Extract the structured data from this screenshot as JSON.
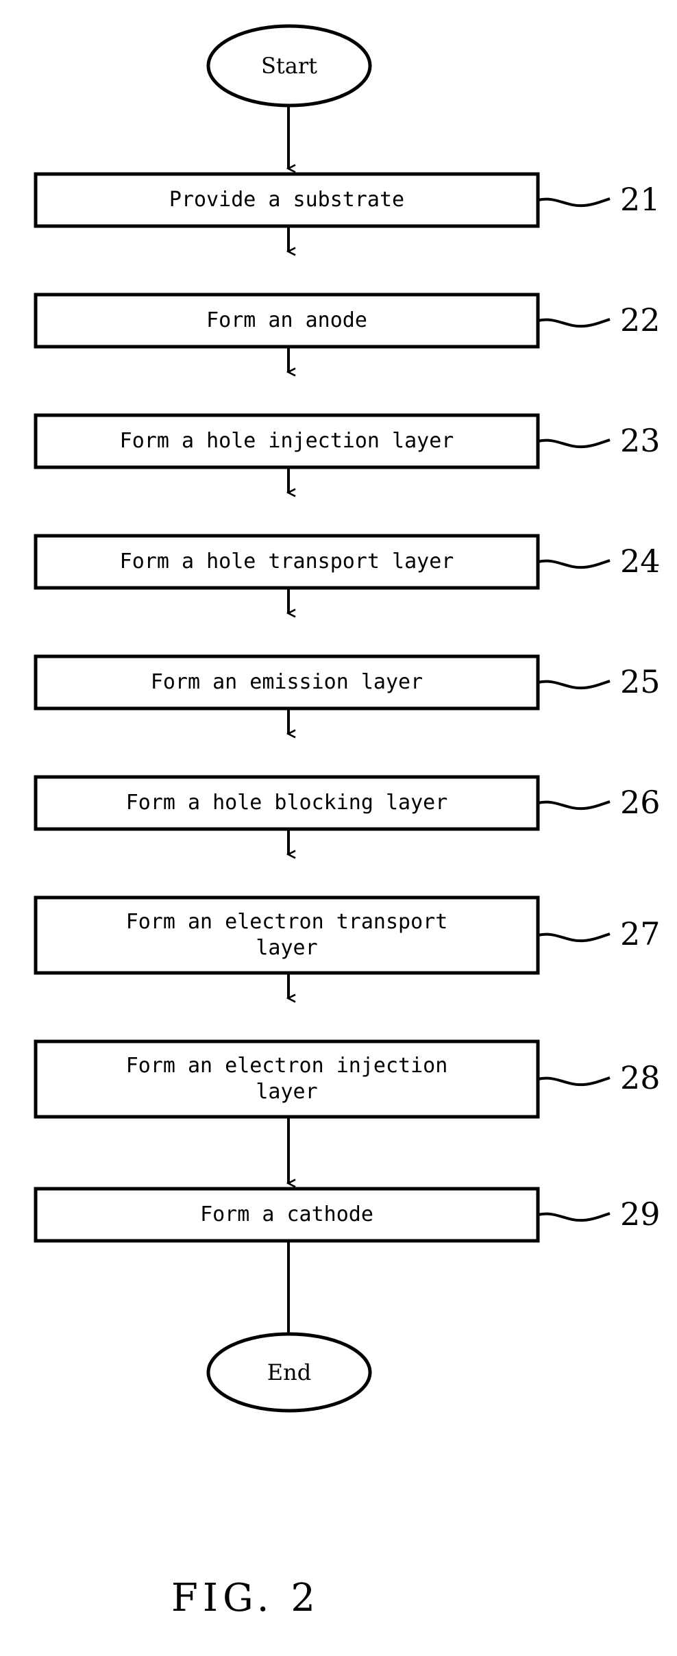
{
  "figure": {
    "caption": "FIG. 2",
    "start_label": "Start",
    "end_label": "End"
  },
  "flowchart": {
    "type": "process-flow",
    "title": "FIG. 2",
    "orientation": "vertical",
    "steps": [
      {
        "ref": "21",
        "label": "Provide a substrate",
        "lines": [
          "Provide a substrate"
        ]
      },
      {
        "ref": "22",
        "label": "Form an anode",
        "lines": [
          "Form an anode"
        ]
      },
      {
        "ref": "23",
        "label": "Form a hole injection layer",
        "lines": [
          "Form a hole injection layer"
        ]
      },
      {
        "ref": "24",
        "label": "Form a hole transport layer",
        "lines": [
          "Form a hole transport layer"
        ]
      },
      {
        "ref": "25",
        "label": "Form an emission layer",
        "lines": [
          "Form an emission layer"
        ]
      },
      {
        "ref": "26",
        "label": "Form a hole blocking layer",
        "lines": [
          "Form a hole blocking layer"
        ]
      },
      {
        "ref": "27",
        "label": "Form an electron transport layer",
        "lines": [
          "Form an electron transport",
          "layer"
        ]
      },
      {
        "ref": "28",
        "label": "Form an electron injection layer",
        "lines": [
          "Form an electron injection",
          "layer"
        ]
      },
      {
        "ref": "29",
        "label": "Form a cathode",
        "lines": [
          "Form a cathode"
        ]
      }
    ],
    "colors": {
      "stroke": "#000000",
      "fill": "#ffffff",
      "text": "#000000"
    }
  }
}
